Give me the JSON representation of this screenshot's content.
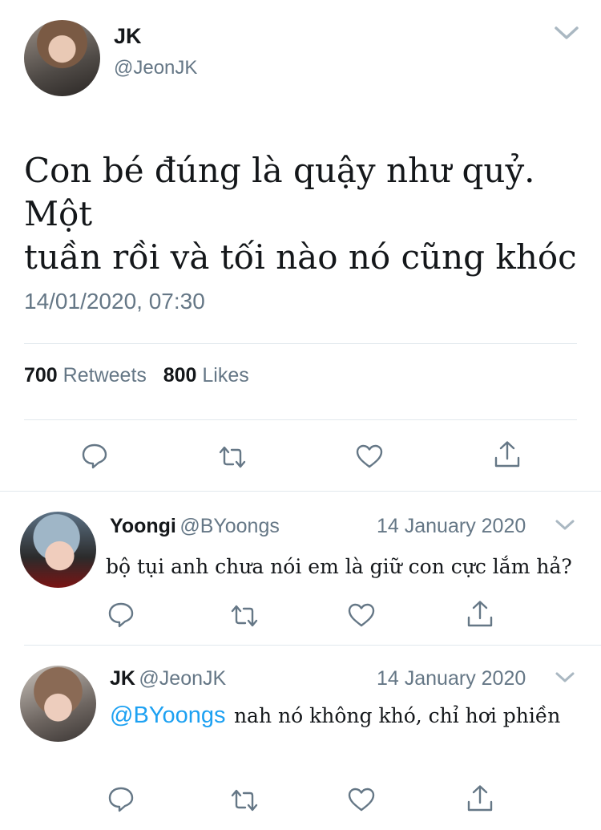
{
  "main_tweet": {
    "display_name": "JK",
    "handle": "@JeonJK",
    "text_line1": "Con bé đúng là quậy như quỷ. Một",
    "text_line2": "tuần rồi và tối nào nó cũng khóc",
    "timestamp": "14/01/2020, 07:30",
    "retweets_count": "700",
    "retweets_label": "Retweets",
    "likes_count": "800",
    "likes_label": "Likes",
    "avatar_icon": "profile-photo",
    "menu_icon": "chevron-down-icon"
  },
  "replies": [
    {
      "display_name": "Yoongi",
      "handle": "@BYoongs",
      "date": "14 January 2020",
      "text": "bộ tụi anh chưa nói em là giữ con cực lắm hả?"
    },
    {
      "display_name": "JK",
      "handle": "@JeonJK",
      "date": "14 January 2020",
      "mention": "@BYoongs",
      "text": "nah nó không khó, chỉ hơi phiền"
    }
  ],
  "colors": {
    "text": "#14171a",
    "secondary": "#657786",
    "divider": "#e1e8ed",
    "link": "#1da1f2"
  },
  "icons": [
    "reply-icon",
    "retweet-icon",
    "like-icon",
    "share-icon",
    "chevron-down-icon"
  ]
}
